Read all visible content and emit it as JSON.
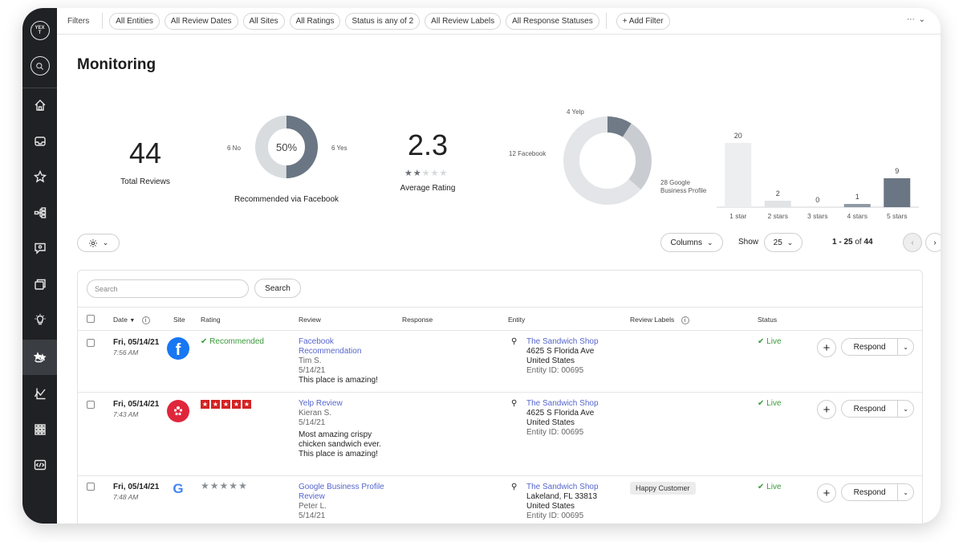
{
  "brand": {
    "logo_text": "YEXT"
  },
  "filters": {
    "label": "Filters",
    "chips": [
      "All Entities",
      "All Review Dates",
      "All Sites",
      "All Ratings",
      "Status is any of 2",
      "All Review Labels",
      "All Response Statuses"
    ],
    "add_label": "+ Add Filter",
    "more_label": "⋯ ⌄"
  },
  "page": {
    "title": "Monitoring"
  },
  "stats": {
    "total_reviews": {
      "value": "44",
      "label": "Total Reviews"
    },
    "recommended": {
      "pct_label": "50%",
      "pct_value": 0.5,
      "no_label": "6 No",
      "yes_label": "6 Yes",
      "caption": "Recommended via Facebook"
    },
    "rating": {
      "value": "2.3",
      "stars_value": 2.3,
      "label": "Average Rating"
    }
  },
  "chart_data": [
    {
      "type": "pie",
      "slices": [
        {
          "label": "4 Yelp",
          "value": 4,
          "color": "#6f7a86"
        },
        {
          "label": "12 Facebook",
          "value": 12,
          "color": "#c9ccd1"
        },
        {
          "label": "28 Google Business Profile",
          "value": 28,
          "color": "#e3e5e8"
        }
      ]
    },
    {
      "type": "bar",
      "categories": [
        "1 star",
        "2 stars",
        "3 stars",
        "4 stars",
        "5 stars"
      ],
      "values": [
        20,
        2,
        0,
        1,
        9
      ],
      "colors": [
        "#eceef0",
        "#e1e3e6",
        "#e1e3e6",
        "#8f99a4",
        "#6a7683"
      ]
    }
  ],
  "controls": {
    "settings_icon": "gear-icon",
    "columns_label": "Columns",
    "show_label": "Show",
    "page_size": "25",
    "pagination_range": "1 - 25",
    "pagination_of": "of",
    "pagination_total": "44"
  },
  "table": {
    "search_placeholder": "Search",
    "search_button": "Search",
    "headers": {
      "date": "Date",
      "site": "Site",
      "rating": "Rating",
      "review": "Review",
      "response": "Response",
      "entity": "Entity",
      "labels": "Review Labels",
      "status": "Status"
    },
    "rows": [
      {
        "date": "Fri, 05/14/21",
        "time": "7:56 AM",
        "site": "facebook",
        "rating_text": "Recommended",
        "review_title": "Facebook Recommendation",
        "reviewer": "Tim S.",
        "review_date": "5/14/21",
        "review_text": "This place is amazing!",
        "entity_name": "The Sandwich Shop",
        "entity_addr1": "4625 S Florida Ave",
        "entity_addr2": "United States",
        "entity_id": "Entity ID: 00695",
        "label": "",
        "status": "Live",
        "respond": "Respond"
      },
      {
        "date": "Fri, 05/14/21",
        "time": "7:43 AM",
        "site": "yelp",
        "rating_stars": 5,
        "review_title": "Yelp Review",
        "reviewer": "Kieran S.",
        "review_date": "5/14/21",
        "review_text": "Most amazing crispy chicken sandwich ever. This place is amazing!",
        "entity_name": "The Sandwich Shop",
        "entity_addr1": "4625 S Florida Ave",
        "entity_addr2": "United States",
        "entity_id": "Entity ID: 00695",
        "label": "",
        "status": "Live",
        "respond": "Respond"
      },
      {
        "date": "Fri, 05/14/21",
        "time": "7:48 AM",
        "site": "google",
        "rating_stars": 5,
        "review_title": "Google Business Profile Review",
        "reviewer": "Peter L.",
        "review_date": "5/14/21",
        "review_text": "",
        "entity_name": "The Sandwich Shop",
        "entity_addr1": "Lakeland, FL 33813",
        "entity_addr2": "United States",
        "entity_id": "Entity ID: 00695",
        "label": "Happy Customer",
        "status": "Live",
        "respond": "Respond"
      }
    ]
  }
}
